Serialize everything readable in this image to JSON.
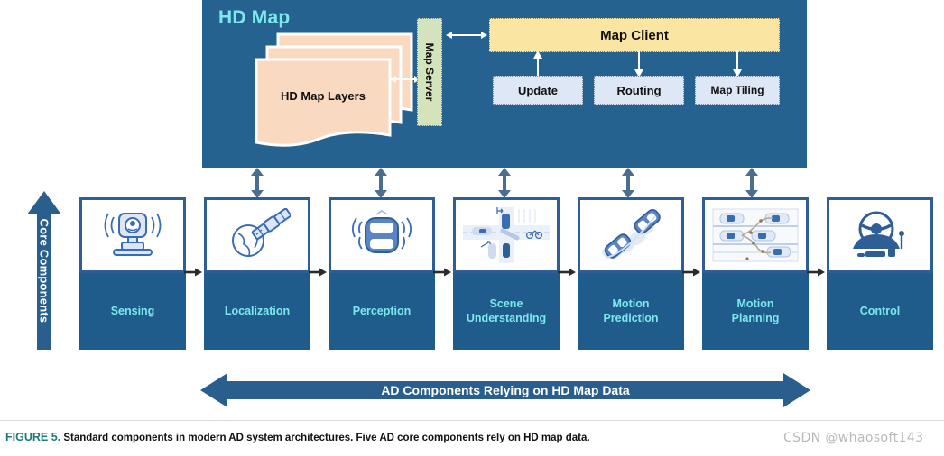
{
  "hd_map": {
    "title": "HD Map",
    "layers_label": "HD Map Layers",
    "map_server_label": "Map Server",
    "map_client_label": "Map Client",
    "services": [
      {
        "label": "Update",
        "name": "update"
      },
      {
        "label": "Routing",
        "name": "routing"
      },
      {
        "label": "Map Tiling",
        "name": "map-tiling"
      }
    ],
    "colors": {
      "panel": "#25628F",
      "title": "#7BE9EC",
      "layers": "#F9D9C0",
      "map_server": "#D3E4BC",
      "map_client": "#FAE5A2",
      "service": "#DEE7F5"
    }
  },
  "core_axis": {
    "label": "Core Components",
    "direction": "up"
  },
  "components": [
    {
      "label": "Sensing",
      "icon": "camera-sensor-icon",
      "relies_on_hd_map": false
    },
    {
      "label": "Localization",
      "icon": "satellite-globe-icon",
      "relies_on_hd_map": true
    },
    {
      "label": "Perception",
      "icon": "car-radar-icon",
      "relies_on_hd_map": true
    },
    {
      "label": "Scene\nUnderstanding",
      "icon": "intersection-scene-icon",
      "relies_on_hd_map": true
    },
    {
      "label": "Motion\nPrediction",
      "icon": "trajectory-cars-icon",
      "relies_on_hd_map": true
    },
    {
      "label": "Motion\nPlanning",
      "icon": "lane-planning-icon",
      "relies_on_hd_map": true
    },
    {
      "label": "Control",
      "icon": "steering-wheel-icon",
      "relies_on_hd_map": false
    }
  ],
  "bottom_arrow": {
    "label": "AD Components Relying on HD Map Data",
    "direction": "both"
  },
  "caption": {
    "figure_number": "FIGURE 5.",
    "text": "Standard components in modern AD system architectures. Five AD core components rely on HD map data."
  },
  "watermark": "CSDN @whaosoft143"
}
